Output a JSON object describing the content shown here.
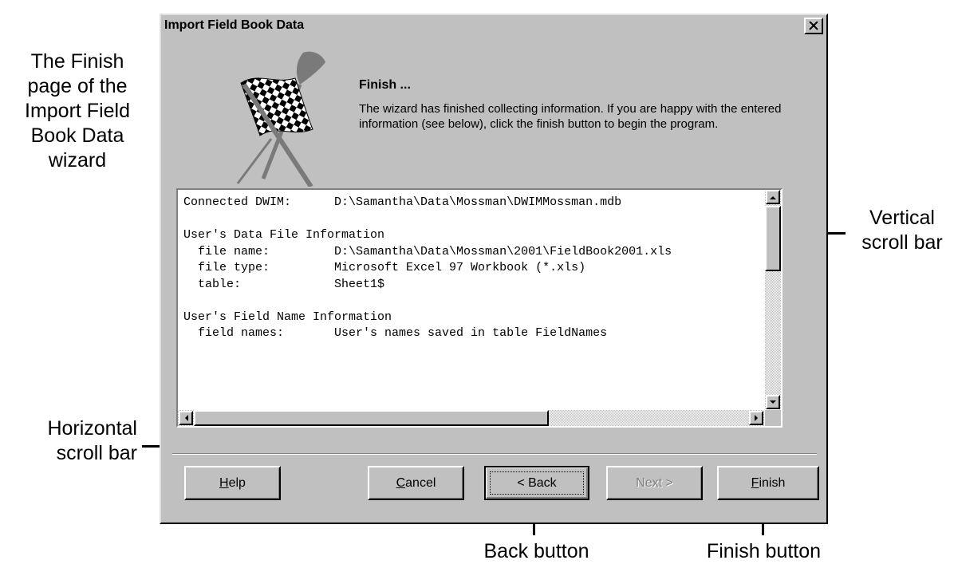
{
  "annotations": {
    "title_lines": [
      "The Finish",
      "page of the",
      "Import Field",
      "Book Data",
      "wizard"
    ],
    "vertical_scroll_lines": [
      "Vertical",
      "scroll bar"
    ],
    "horizontal_scroll_lines": [
      "Horizontal",
      "scroll bar"
    ],
    "back_button": "Back button",
    "finish_button": "Finish button"
  },
  "dialog": {
    "title": "Import Field Book Data",
    "heading": "Finish ...",
    "description": "The wizard has finished collecting information.  If you are happy with the entered information (see below), click the finish button to begin the program.",
    "info_lines": [
      "Connected DWIM:      D:\\Samantha\\Data\\Mossman\\DWIMMossman.mdb",
      "",
      "User's Data File Information",
      "  file name:         D:\\Samantha\\Data\\Mossman\\2001\\FieldBook2001.xls",
      "  file type:         Microsoft Excel 97 Workbook (*.xls)",
      "  table:             Sheet1$",
      "",
      "User's Field Name Information",
      "  field names:       User's names saved in table FieldNames",
      ""
    ],
    "buttons": {
      "help": "Help",
      "cancel": "Cancel",
      "back": "< Back",
      "next": "Next >",
      "finish": "Finish"
    }
  },
  "icons": {
    "close": "close-x-icon",
    "flag": "checkered-flag-icon",
    "scroll_up": "arrow-up-icon",
    "scroll_down": "arrow-down-icon",
    "scroll_left": "arrow-left-icon",
    "scroll_right": "arrow-right-icon"
  },
  "colors": {
    "dialog_face": "#c0c0c0",
    "disabled_text": "#808080"
  }
}
